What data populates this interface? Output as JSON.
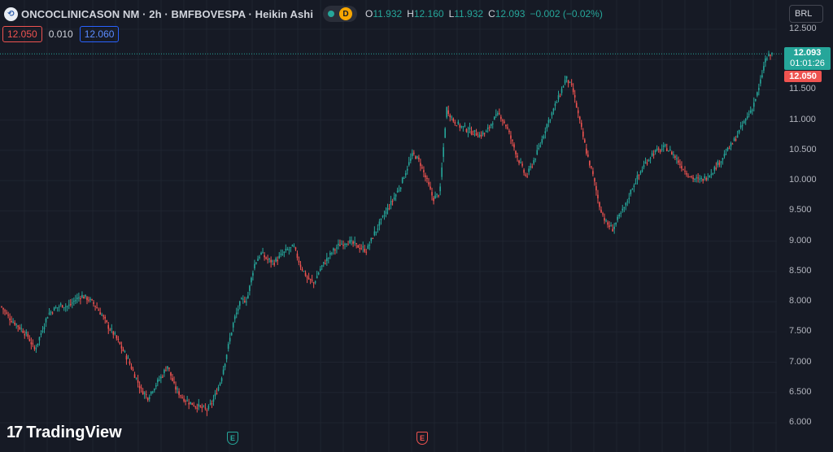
{
  "header": {
    "symbol_title": "ONCOCLINICASON NM · 2h · BMFBOVESPA · Heikin Ashi",
    "logo_letter": "⟲",
    "badge": "D",
    "ohlc": {
      "o_label": "O",
      "o": "11.932",
      "h_label": "H",
      "h": "12.160",
      "l_label": "L",
      "l": "11.932",
      "c_label": "C",
      "c": "12.093",
      "change": "−0.002 (−0.02%)"
    }
  },
  "quote": {
    "sell": "12.050",
    "spread": "0.010",
    "buy": "12.060"
  },
  "currency": "BRL",
  "y_axis": {
    "ticks": [
      "12.500",
      "12.000",
      "11.500",
      "11.000",
      "10.500",
      "10.000",
      "9.500",
      "9.000",
      "8.500",
      "8.000",
      "7.500",
      "7.000",
      "6.500",
      "6.000"
    ]
  },
  "last_price": {
    "price": "12.093",
    "countdown": "01:01:26",
    "bid": "12.050"
  },
  "brand": {
    "mark": "17",
    "name": "TradingView"
  },
  "events": [
    {
      "letter": "E"
    },
    {
      "letter": "E"
    }
  ],
  "colors": {
    "up": "#26a69a",
    "down": "#ef5350",
    "background": "#161a25",
    "grid": "#1f2430"
  },
  "chart_data": {
    "type": "candlestick",
    "chart_style": "Heikin Ashi",
    "interval": "2h",
    "ylim": [
      6.0,
      12.5
    ],
    "close_path": [
      7.92,
      7.75,
      7.65,
      7.55,
      7.42,
      7.2,
      7.5,
      7.8,
      7.88,
      7.95,
      7.92,
      8.02,
      8.1,
      8.05,
      7.95,
      7.8,
      7.6,
      7.45,
      7.25,
      7.05,
      6.8,
      6.55,
      6.42,
      6.6,
      6.75,
      6.95,
      6.6,
      6.45,
      6.35,
      6.3,
      6.25,
      6.2,
      6.4,
      6.7,
      7.2,
      7.7,
      8.0,
      8.05,
      8.6,
      8.8,
      8.7,
      8.65,
      8.75,
      8.85,
      8.9,
      8.6,
      8.4,
      8.3,
      8.55,
      8.7,
      8.85,
      8.95,
      9.0,
      8.95,
      8.9,
      8.85,
      9.1,
      9.3,
      9.5,
      9.7,
      9.9,
      10.2,
      10.45,
      10.3,
      10.0,
      9.7,
      9.8,
      11.2,
      11.0,
      10.9,
      10.85,
      10.8,
      10.75,
      10.8,
      11.0,
      11.1,
      10.9,
      10.6,
      10.3,
      10.05,
      10.3,
      10.55,
      10.9,
      11.15,
      11.4,
      11.7,
      11.5,
      11.0,
      10.5,
      10.1,
      9.6,
      9.3,
      9.2,
      9.4,
      9.6,
      9.9,
      10.1,
      10.3,
      10.45,
      10.5,
      10.55,
      10.45,
      10.3,
      10.15,
      10.05,
      10.0,
      10.05,
      10.15,
      10.3,
      10.45,
      10.6,
      10.8,
      11.0,
      11.2,
      11.5,
      12.0,
      12.09
    ]
  }
}
